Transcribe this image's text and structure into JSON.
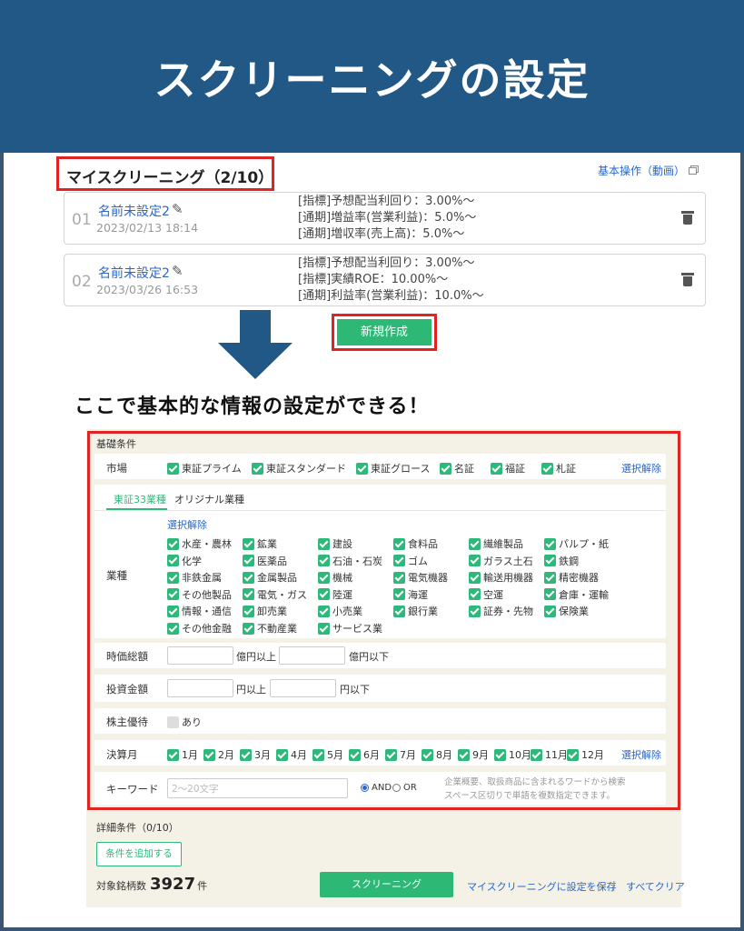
{
  "banner": {
    "title": "スクリーニングの設定"
  },
  "my_screening": {
    "title": "マイスクリーニング（2/10）",
    "basic_ops_link": "基本操作（動画）",
    "items": [
      {
        "num": "01",
        "name": "名前未設定2",
        "date": "2023/02/13 18:14",
        "conditions": [
          "[指標]予想配当利回り：3.00%〜",
          "[通期]増益率(営業利益)：5.0%〜",
          "[通期]増収率(売上高)：5.0%〜"
        ]
      },
      {
        "num": "02",
        "name": "名前未設定2",
        "date": "2023/03/26 16:53",
        "conditions": [
          "[指標]予想配当利回り：3.00%〜",
          "[指標]実績ROE：10.00%〜",
          "[通期]利益率(営業利益)：10.0%〜"
        ]
      }
    ],
    "new_button": "新規作成"
  },
  "caption": "ここで基本的な情報の設定ができる！",
  "form": {
    "basic_label": "基礎条件",
    "market": {
      "label": "市場",
      "options": [
        "東証プライム",
        "東証スタンダード",
        "東証グロース",
        "名証",
        "福証",
        "札証"
      ],
      "deselect": "選択解除"
    },
    "industry": {
      "label": "業種",
      "tabs": [
        "東証33業種",
        "オリジナル業種"
      ],
      "deselect": "選択解除",
      "options": [
        "水産・農林",
        "鉱業",
        "建設",
        "食料品",
        "繊維製品",
        "パルプ・紙",
        "化学",
        "医薬品",
        "石油・石炭",
        "ゴム",
        "ガラス土石",
        "鉄鋼",
        "非鉄金属",
        "金属製品",
        "機械",
        "電気機器",
        "輸送用機器",
        "精密機器",
        "その他製品",
        "電気・ガス",
        "陸運",
        "海運",
        "空運",
        "倉庫・運輸",
        "情報・通信",
        "卸売業",
        "小売業",
        "銀行業",
        "証券・先物",
        "保険業",
        "その他金融",
        "不動産業",
        "サービス業"
      ]
    },
    "market_cap": {
      "label": "時価総額",
      "min_unit": "億円以上",
      "max_unit": "億円以下"
    },
    "investment": {
      "label": "投資金額",
      "min_unit": "円以上",
      "max_unit": "円以下"
    },
    "benefit": {
      "label": "株主優待",
      "option": "あり"
    },
    "fiscal_month": {
      "label": "決算月",
      "months": [
        "1月",
        "2月",
        "3月",
        "4月",
        "5月",
        "6月",
        "7月",
        "8月",
        "9月",
        "10月",
        "11月",
        "12月"
      ],
      "deselect": "選択解除"
    },
    "keyword": {
      "label": "キーワード",
      "placeholder": "2〜20文字",
      "and_label": "AND",
      "or_label": "OR",
      "help_line1": "企業概要、取扱商品に含まれるワードから検索",
      "help_line2": "スペース区切りで単語を複数指定できます。"
    },
    "detail_label": "詳細条件（0/10）",
    "add_button": "条件を追加する",
    "count_prefix": "対象銘柄数",
    "count": "3927",
    "count_suffix": "件",
    "screening_button": "スクリーニング",
    "save_link": "マイスクリーニングに設定を保存",
    "separator": "|",
    "clear_link": "すべてクリア"
  },
  "colors": {
    "banner": "#225886",
    "accent_green": "#2db876",
    "link_blue": "#2b67c9",
    "highlight_red": "#e02424"
  }
}
